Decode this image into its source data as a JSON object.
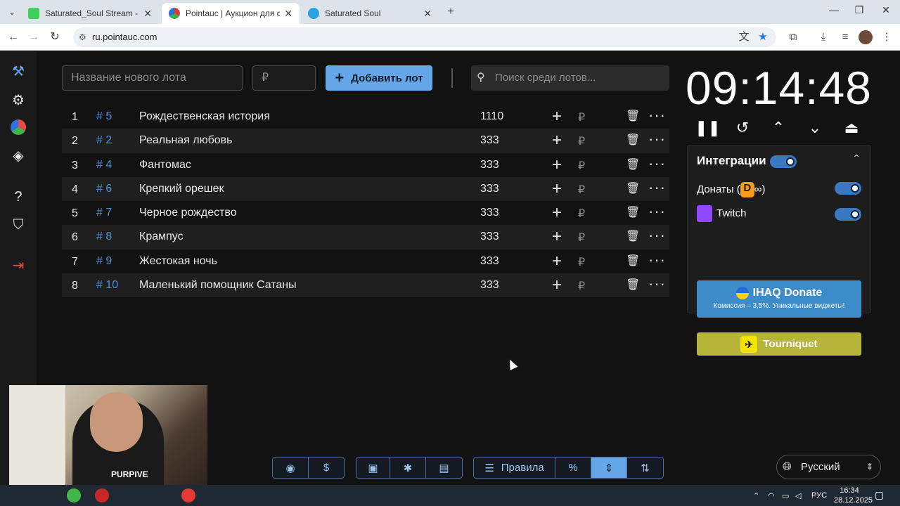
{
  "browser": {
    "tabs": [
      {
        "title": "Saturated_Soul Stream - Watch",
        "favicon_color": "#3bd15c",
        "active": false
      },
      {
        "title": "Pointauc | Аукцион для стриме",
        "favicon_color": "#d83b3b",
        "active": true
      },
      {
        "title": "Saturated Soul",
        "favicon_color": "#2aa3e0",
        "active": false
      }
    ],
    "url": "ru.pointauc.com"
  },
  "toolbar": {
    "lot_name_placeholder": "Название нового лота",
    "amount_placeholder": "₽",
    "add_label": "Добавить лот",
    "search_placeholder": "Поиск среди лотов..."
  },
  "lots": [
    {
      "index": "1",
      "id": "# 5",
      "name": "Рождественская история",
      "amount": "1110"
    },
    {
      "index": "2",
      "id": "# 2",
      "name": "Реальная любовь",
      "amount": "333"
    },
    {
      "index": "3",
      "id": "# 4",
      "name": "Фантомас",
      "amount": "333"
    },
    {
      "index": "4",
      "id": "# 6",
      "name": "Крепкий орешек",
      "amount": "333"
    },
    {
      "index": "5",
      "id": "# 7",
      "name": "Черное рождество",
      "amount": "333"
    },
    {
      "index": "6",
      "id": "# 8",
      "name": "Крампус",
      "amount": "333"
    },
    {
      "index": "7",
      "id": "# 9",
      "name": "Жестокая ночь",
      "amount": "333"
    },
    {
      "index": "8",
      "id": "# 10",
      "name": "Маленький помощник Сатаны",
      "amount": "333"
    }
  ],
  "row_currency": "₽",
  "timer": {
    "value": "09:14:48"
  },
  "integrations": {
    "title": "Интеграции",
    "enabled": true,
    "items": [
      {
        "label": "Донаты (",
        "label_suffix": ")",
        "enabled": true
      },
      {
        "label": "Twitch",
        "enabled": true
      }
    ],
    "ihaq": {
      "title": "IHAQ Donate",
      "subtitle": "Комиссия – 3,5%. Уникальные виджеты!"
    },
    "tourniquet": {
      "label": "Tourniquet"
    }
  },
  "bottom": {
    "rules_label": "Правила",
    "percent_label": "%"
  },
  "language": {
    "selected": "Русский"
  },
  "webcam": {
    "shirt_text": "PURPIVE"
  },
  "taskbar": {
    "lang": "РУС",
    "time": "16:34",
    "date": "28.12.2025"
  },
  "colors": {
    "accent": "#64a6e8",
    "lot_id": "#4a90d9",
    "ihaq": "#3b8cc9",
    "tourniquet": "#b6b53a",
    "twitch": "#9146ff"
  }
}
